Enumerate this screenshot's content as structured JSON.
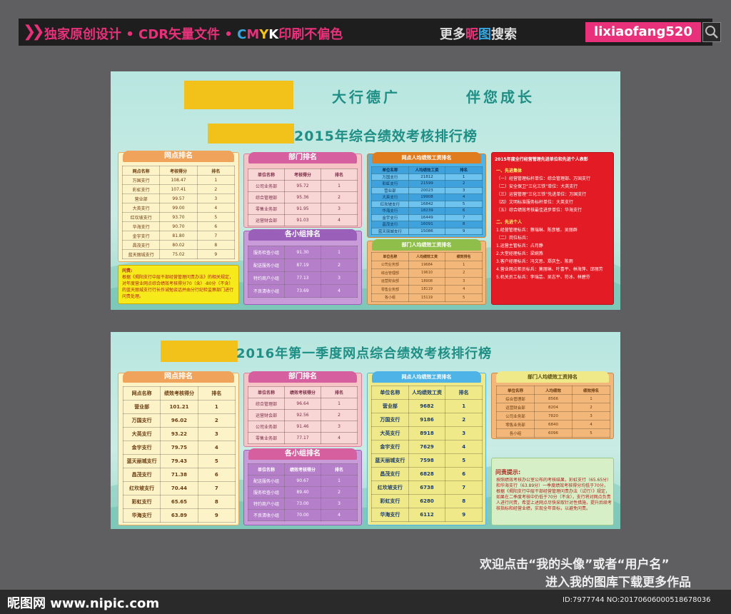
{
  "banner": {
    "ad_prefix": "独家原创设计 • CDR矢量文件 • ",
    "cmyk": [
      "C",
      "M",
      "Y",
      "K"
    ],
    "cmyk_colors": [
      "#35a7e0",
      "#e8317a",
      "#f2c21a",
      "#ffffff"
    ],
    "ad_suffix": "印刷不偏色",
    "more_a": "更多",
    "more_ni": "昵",
    "more_tu": "图",
    "more_b": "搜索",
    "username": "lixiaofang520",
    "search_icon": "search-icon"
  },
  "board1": {
    "slogan_left": "大行德广",
    "slogan_right": "伴您成长",
    "title": "2015年综合绩效考核排行榜",
    "branch": {
      "tab": "网点排名",
      "header": [
        "网点名称",
        "考核得分",
        "排名"
      ],
      "rows": [
        [
          "万国支行",
          "108.47",
          "1"
        ],
        [
          "彩虹支行",
          "107.41",
          "2"
        ],
        [
          "营业部",
          "99.57",
          "3"
        ],
        [
          "大英支行",
          "99.00",
          "4"
        ],
        [
          "红坎坡支行",
          "93.70",
          "5"
        ],
        [
          "华海支行",
          "90.70",
          "6"
        ],
        [
          "金宇支行",
          "81.80",
          "7"
        ],
        [
          "昌茂支行",
          "80.02",
          "8"
        ],
        [
          "蓝天丽城支行",
          "75.02",
          "9"
        ]
      ],
      "note_title": "问责:",
      "note": "根据《揭阳支行中层干部经营管理问责办法》的相关规定，对年度营业网点综合绩效考核得分70（含）-80分（不含）的蓝天丽城支行行长作诫勉谈话并由分行纪检监察部门进行问责处理。"
    },
    "dept": {
      "tab": "部门排名",
      "header": [
        "单位名称",
        "考核得分",
        "排名"
      ],
      "rows": [
        [
          "公司业务部",
          "95.72",
          "1"
        ],
        [
          "综合管理部",
          "95.36",
          "2"
        ],
        [
          "零售业务部",
          "91.95",
          "3"
        ],
        [
          "运营财会部",
          "91.03",
          "4"
        ]
      ]
    },
    "group": {
      "tab": "各小组排名",
      "rows": [
        [
          "服务检查小组",
          "91.30",
          "1"
        ],
        [
          "配送服务小组",
          "87.19",
          "2"
        ],
        [
          "特约商户小组",
          "77.13",
          "3"
        ],
        [
          "不良清收小组",
          "73.69",
          "4"
        ]
      ]
    },
    "salary_branch": {
      "tab": "网点人均绩效工资排名",
      "header": [
        "单位名称",
        "人均绩效工资",
        "排名"
      ],
      "rows": [
        [
          "万国支行",
          "21812",
          "1"
        ],
        [
          "彩虹支行",
          "21599",
          "2"
        ],
        [
          "营业部",
          "20023",
          "3"
        ],
        [
          "大英支行",
          "19908",
          "4"
        ],
        [
          "红坎坡支行",
          "16842",
          "5"
        ],
        [
          "华海支行",
          "18239",
          "6"
        ],
        [
          "金宇支行",
          "16449",
          "7"
        ],
        [
          "昌茂支行",
          "16091",
          "8"
        ],
        [
          "蓝天丽城支行",
          "15086",
          "9"
        ]
      ]
    },
    "salary_dept": {
      "tab": "部门人均绩效工资排名",
      "header": [
        "单位名称",
        "人均绩效工资",
        "绩效排名"
      ],
      "rows": [
        [
          "公司业务部",
          "19684",
          "1"
        ],
        [
          "综合管理部",
          "19610",
          "2"
        ],
        [
          "运营财会部",
          "18908",
          "3"
        ],
        [
          "零售业务部",
          "18119",
          "4"
        ],
        [
          "各小组",
          "15119",
          "5"
        ]
      ]
    },
    "award": {
      "title": "2015年度全行经营管理先进单位和先进个人表彰",
      "lines": [
        "一、先进集体",
        "（一）经营管理标杆单位：综合管理部、万国支行",
        "（二）安全保卫“三化三铁”单位：大英支行",
        "（三）运营管理“三化三铁”先进单位：万国支行",
        "（四）文明标准服务标杆单位：大英支行",
        "（五）综合绩效考核最佳进步单位：华海支行",
        "二、先进个人",
        "1.经营管理标兵：蔡瑞琳、陈彦敏、吴丽群",
        "（二）岗位标兵：",
        "1.运营主管标兵：占月静",
        "2.大堂经理标兵：梁婉燕",
        "3.客户经理标兵：冯文思、郑庆生、陈雨",
        "4.营业网点柜员标兵：莫丽琳、叶喜平、林海萍、邱丽芳",
        "5.机关员工标兵：李瑞芸、吴志平、符冰、林碧芬"
      ]
    }
  },
  "board2": {
    "title": "2016年第一季度网点综合绩效考核排行榜",
    "branch": {
      "tab": "网点排名",
      "header": [
        "网点名称",
        "绩效考核得分",
        "排名"
      ],
      "rows": [
        [
          "营业部",
          "101.21",
          "1"
        ],
        [
          "万国支行",
          "96.02",
          "2"
        ],
        [
          "大英支行",
          "93.22",
          "3"
        ],
        [
          "金宇支行",
          "79.75",
          "4"
        ],
        [
          "蓝天丽城支行",
          "79.43",
          "5"
        ],
        [
          "昌茂支行",
          "71.38",
          "6"
        ],
        [
          "红坎坡支行",
          "70.44",
          "7"
        ],
        [
          "彩虹支行",
          "65.65",
          "8"
        ],
        [
          "华海支行",
          "63.89",
          "9"
        ]
      ]
    },
    "dept": {
      "tab": "部门排名",
      "header": [
        "单位名称",
        "绩效考核得分",
        "排名"
      ],
      "rows": [
        [
          "综合管理部",
          "96.64",
          "1"
        ],
        [
          "运营财会部",
          "92.56",
          "2"
        ],
        [
          "公司业务部",
          "91.46",
          "3"
        ],
        [
          "零售业务部",
          "77.17",
          "4"
        ]
      ]
    },
    "group": {
      "tab": "各小组排名",
      "header": [
        "单位名称",
        "绩效考核得分",
        "排名"
      ],
      "rows": [
        [
          "配送服务小组",
          "90.67",
          "1"
        ],
        [
          "服务检查小组",
          "89.40",
          "2"
        ],
        [
          "特约商户小组",
          "73.00",
          "3"
        ],
        [
          "不良清收小组",
          "70.00",
          "4"
        ]
      ]
    },
    "salary_branch": {
      "tab": "网点人均绩效工资排名",
      "header": [
        "单位名称",
        "人均绩效工资",
        "排名"
      ],
      "rows": [
        [
          "营业部",
          "9682",
          "1"
        ],
        [
          "万国支行",
          "9186",
          "2"
        ],
        [
          "大英支行",
          "8918",
          "3"
        ],
        [
          "金宇支行",
          "7629",
          "4"
        ],
        [
          "蓝天丽城支行",
          "7598",
          "5"
        ],
        [
          "昌茂支行",
          "6828",
          "6"
        ],
        [
          "红坎坡支行",
          "6738",
          "7"
        ],
        [
          "彩虹支行",
          "6280",
          "8"
        ],
        [
          "华海支行",
          "6112",
          "9"
        ]
      ]
    },
    "salary_dept": {
      "tab": "部门人均绩效工资排名",
      "header": [
        "单位名称",
        "人均绩效",
        "绩效排名"
      ],
      "rows": [
        [
          "综合管理部",
          "8566",
          "1"
        ],
        [
          "运营财会部",
          "8204",
          "2"
        ],
        [
          "公司业务部",
          "7820",
          "3"
        ],
        [
          "零售业务部",
          "6840",
          "4"
        ],
        [
          "各小组",
          "6096",
          "5"
        ]
      ]
    },
    "tips": {
      "title": "问责提示:",
      "text": "按照绩效考核办公室公布的考核结果，彩虹支行（65.65分）和华海支行（63.89分）一季度绩效考核得分均低于70分，根据《揭阳支行中层干部经营管理问责办法（试行）》规定，如果在二季度考核中仍低于70分（不含），支行将对网点负责人进行问责，希望上述网点尽快采取针对性措施，提升后续考核指标和经营业绩，实现全年目标，以避免问责。"
    }
  },
  "bottom": {
    "welcome1": "欢迎点击“我的头像”或者“用户名”",
    "welcome2": "进入我的图库下载更多作品",
    "logo": "昵图网 www.nipic.com",
    "id_line": "ID:7977744 NO:20170606000518678036"
  }
}
